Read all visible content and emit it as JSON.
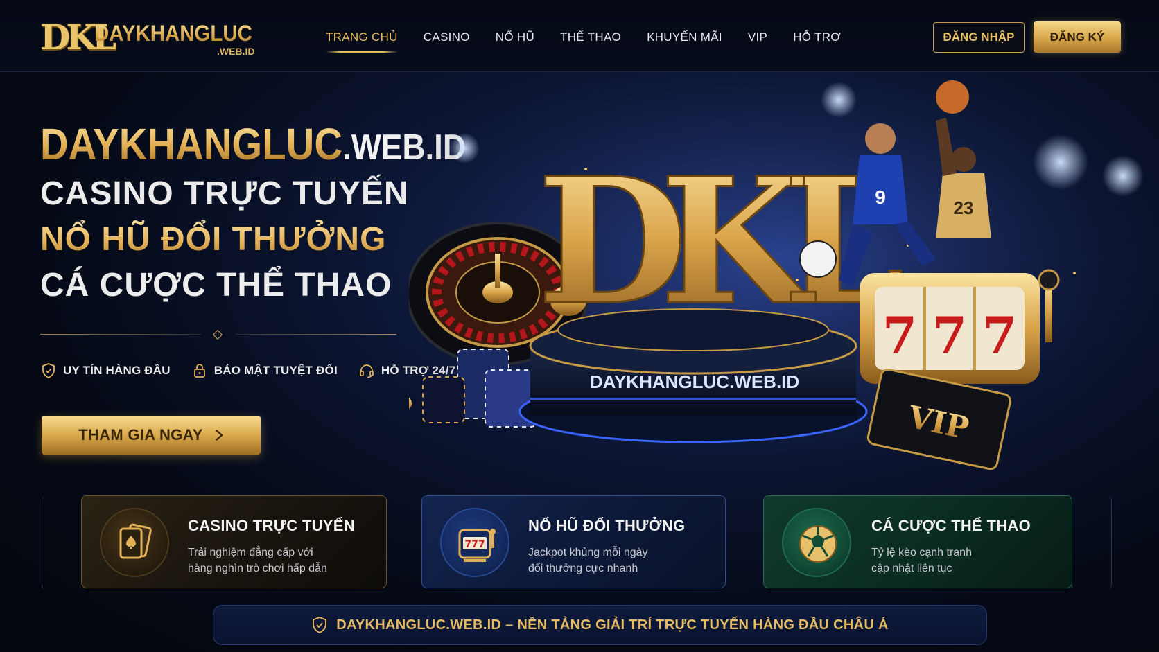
{
  "brand": {
    "mark": "DKL",
    "name": "DAYKHANGLUC",
    "suffix": ".WEB.ID"
  },
  "nav": {
    "items": [
      {
        "label": "TRANG CHỦ",
        "active": true
      },
      {
        "label": "CASINO"
      },
      {
        "label": "NỔ HŨ"
      },
      {
        "label": "THỂ THAO"
      },
      {
        "label": "KHUYẾN MÃI"
      },
      {
        "label": "VIP"
      },
      {
        "label": "HỖ TRỢ"
      }
    ],
    "login_label": "ĐĂNG NHẬP",
    "register_label": "ĐĂNG KÝ"
  },
  "hero": {
    "title_gold": "DAYKHANGLUC",
    "title_white": ".WEB.ID",
    "line1": "CASINO TRỰC TUYẾN",
    "line2": "NỔ HŨ ĐỔI THƯỞNG",
    "line3": "CÁ CƯỢC THỂ THAO",
    "features": [
      {
        "icon": "shield-icon",
        "label": "UY TÍN HÀNG ĐẦU"
      },
      {
        "icon": "lock-icon",
        "label": "BẢO MẬT TUYỆT ĐỐI"
      },
      {
        "icon": "headset-icon",
        "label": "HỖ TRỢ 24/7"
      }
    ],
    "cta_label": "THAM GIA NGAY",
    "art": {
      "logo_mark": "DKL",
      "pedestal_text": "DAYKHANGLUC.WEB.ID",
      "vip_card_text": "VIP",
      "slot_symbols": [
        "7",
        "7",
        "7"
      ],
      "jersey_numbers": [
        "9",
        "23"
      ]
    }
  },
  "cards": [
    {
      "icon": "playing-cards-icon",
      "title": "CASINO TRỰC TUYẾN",
      "desc1": "Trải nghiệm đẳng cấp với",
      "desc2": "hàng nghìn trò chơi hấp dẫn"
    },
    {
      "icon": "slot-machine-icon",
      "title": "NỔ HŨ ĐỔI THƯỞNG",
      "desc1": "Jackpot khủng mỗi ngày",
      "desc2": "đổi thưởng cực nhanh"
    },
    {
      "icon": "soccer-ball-icon",
      "title": "CÁ CƯỢC THỂ THAO",
      "desc1": "Tỷ lệ kèo cạnh tranh",
      "desc2": "cập nhật liên tục"
    }
  ],
  "banner": {
    "icon": "shield-icon",
    "text": "DAYKHANGLUC.WEB.ID – NỀN TẢNG GIẢI TRÍ TRỰC TUYẾN HÀNG ĐẦU CHÂU Á"
  },
  "colors": {
    "gold": "#e3b158",
    "navy": "#0b1430",
    "green": "#0f3a2c"
  }
}
